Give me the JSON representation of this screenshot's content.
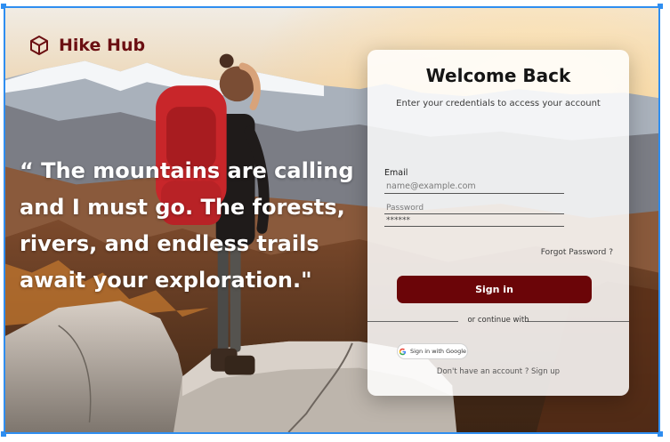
{
  "brand": {
    "name": "Hike Hub",
    "icon": "cube-icon",
    "color": "#6b0f12"
  },
  "hero": {
    "quote": "“ The mountains are calling and I must go. The forests, rivers, and endless trails await your exploration.\""
  },
  "login": {
    "title": "Welcome Back",
    "subtitle": "Enter your credentials to access your account",
    "email_label": "Email",
    "email_placeholder": "name@example.com",
    "password_placeholder": "Password",
    "password_value": "******",
    "forgot_label": "Forgot Password ?",
    "signin_label": "Sign in",
    "divider_label": "or continue with",
    "google_label": "Sign in with Google",
    "signup_text": "Don't have an account ?",
    "signup_link": "Sign up",
    "accent": "#6b0508"
  }
}
